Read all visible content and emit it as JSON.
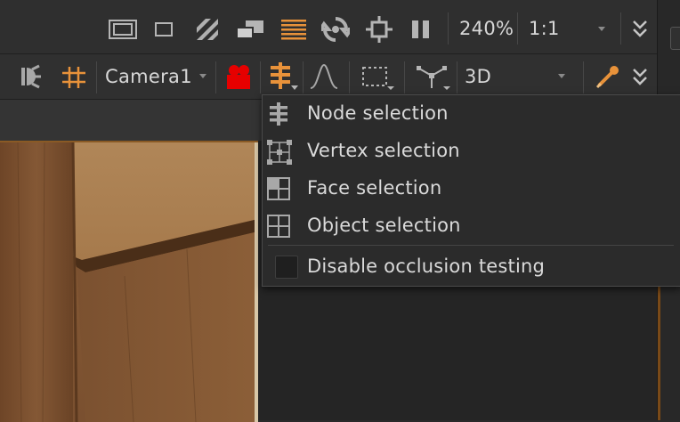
{
  "toolbar_top": {
    "zoom": "240%",
    "ratio": "1:1"
  },
  "toolbar_second": {
    "camera": "Camera1",
    "view_mode": "3D"
  },
  "selection_menu": {
    "items": [
      {
        "label": "Node selection",
        "icon": "node-selection-icon"
      },
      {
        "label": "Vertex selection",
        "icon": "vertex-selection-icon"
      },
      {
        "label": "Face selection",
        "icon": "face-selection-icon"
      },
      {
        "label": "Object selection",
        "icon": "object-selection-icon"
      }
    ],
    "checkbox_label": "Disable occlusion testing",
    "checkbox_checked": false
  },
  "colors": {
    "accent": "#e8923a",
    "camera_red": "#e60000",
    "background": "#2a2a2a"
  }
}
